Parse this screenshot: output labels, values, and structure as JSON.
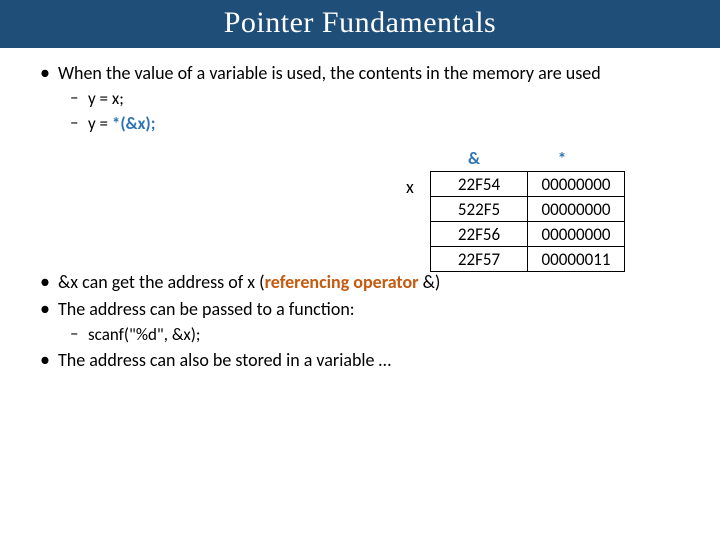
{
  "title": "Pointer Fundamentals",
  "p1": {
    "lead": "When the value of a variable is used, the contents in the memory are used",
    "s1": "y = x;",
    "s2a": "y = ",
    "s2b": "*(&x);"
  },
  "table": {
    "h1": "&",
    "h2": "*",
    "xlabel": "x",
    "rows": [
      {
        "addr": "22F54",
        "val": "00000000"
      },
      {
        "addr": "522F5",
        "val": "00000000"
      },
      {
        "addr": "22F56",
        "val": "00000000"
      },
      {
        "addr": "22F57",
        "val": "00000011"
      }
    ]
  },
  "p2": {
    "a1": "&x can get the address of x (",
    "a2": "referencing operator ",
    "a3": "&)",
    "b": "The address can be passed to a function:",
    "b1": "scanf(\"%d\", &x);",
    "c": "The address can also be stored in a variable …"
  }
}
